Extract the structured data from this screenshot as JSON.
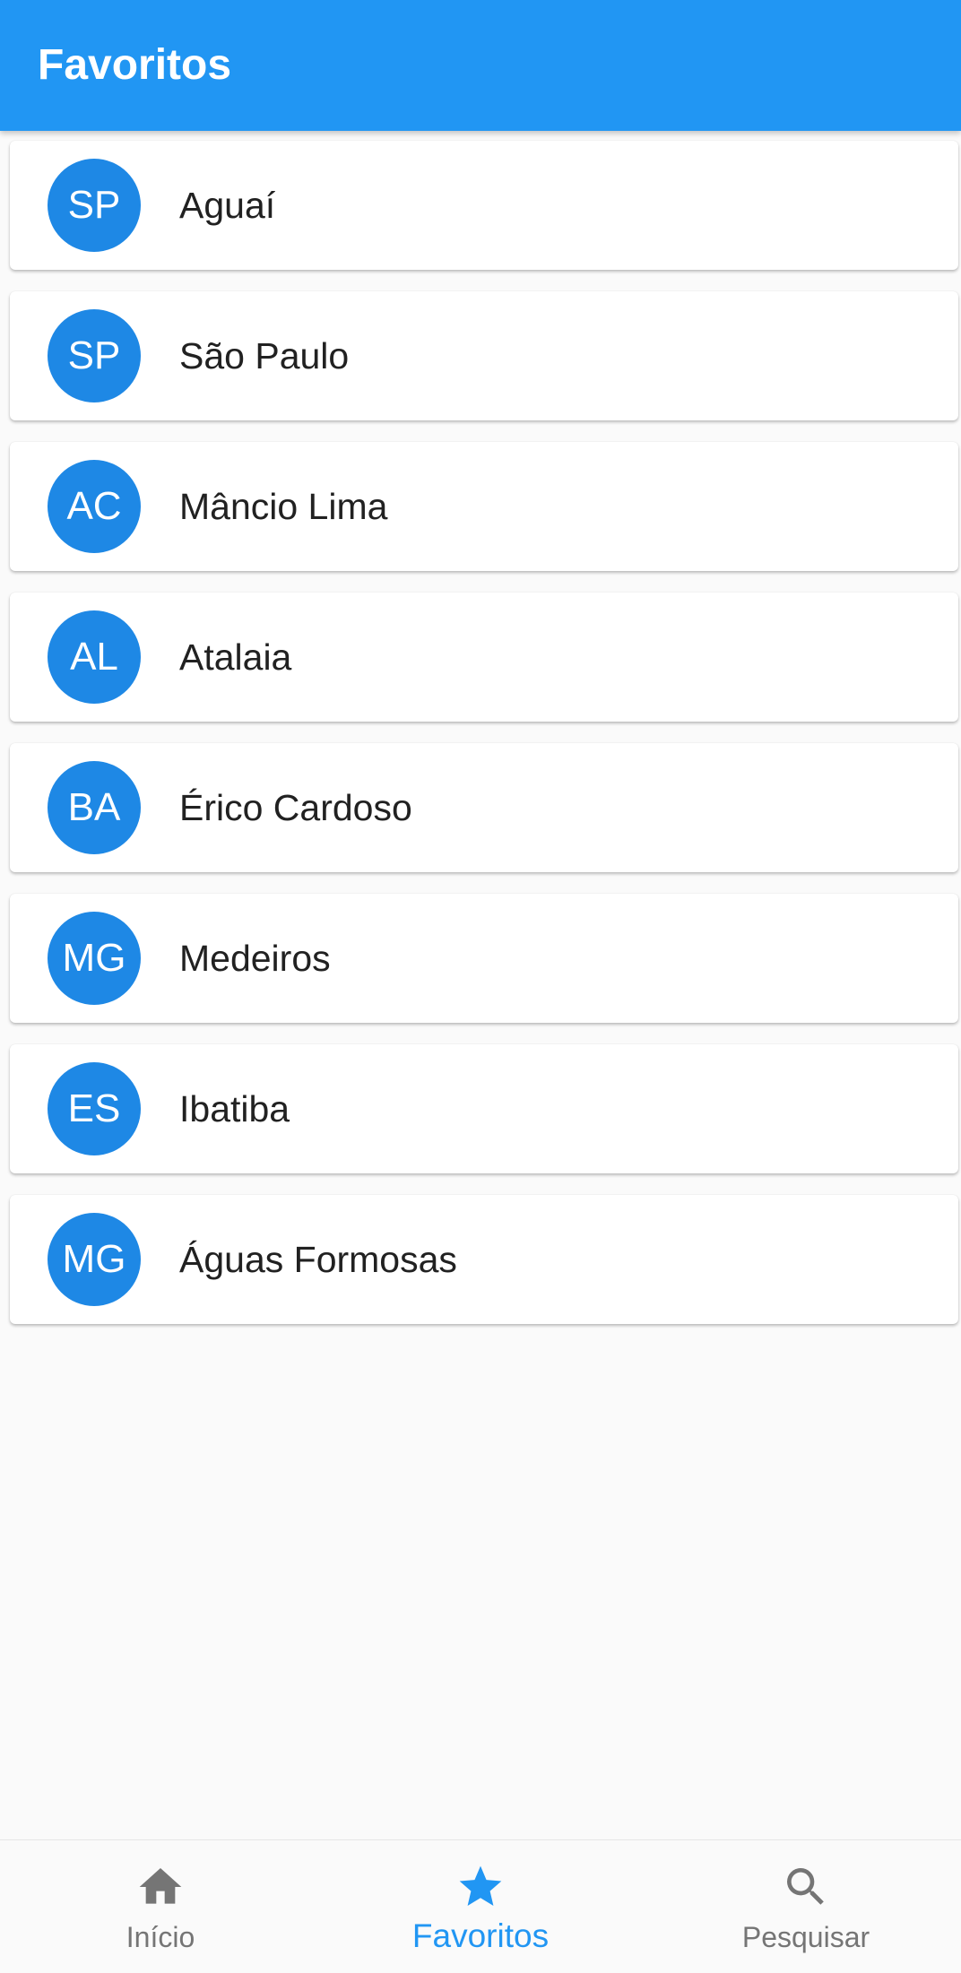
{
  "app_bar": {
    "title": "Favoritos",
    "color": "#2196f3"
  },
  "favorites": [
    {
      "state": "SP",
      "city": "Aguaí"
    },
    {
      "state": "SP",
      "city": "São Paulo"
    },
    {
      "state": "AC",
      "city": "Mâncio Lima"
    },
    {
      "state": "AL",
      "city": "Atalaia"
    },
    {
      "state": "BA",
      "city": "Érico Cardoso"
    },
    {
      "state": "MG",
      "city": "Medeiros"
    },
    {
      "state": "ES",
      "city": "Ibatiba"
    },
    {
      "state": "MG",
      "city": "Águas Formosas"
    }
  ],
  "avatar_color": "#1e88e5",
  "bottom_nav": {
    "active_color": "#2196f3",
    "inactive_color": "#757575",
    "items": [
      {
        "label": "Início",
        "icon": "home-icon",
        "active": false
      },
      {
        "label": "Favoritos",
        "icon": "star-icon",
        "active": true
      },
      {
        "label": "Pesquisar",
        "icon": "search-icon",
        "active": false
      }
    ]
  }
}
